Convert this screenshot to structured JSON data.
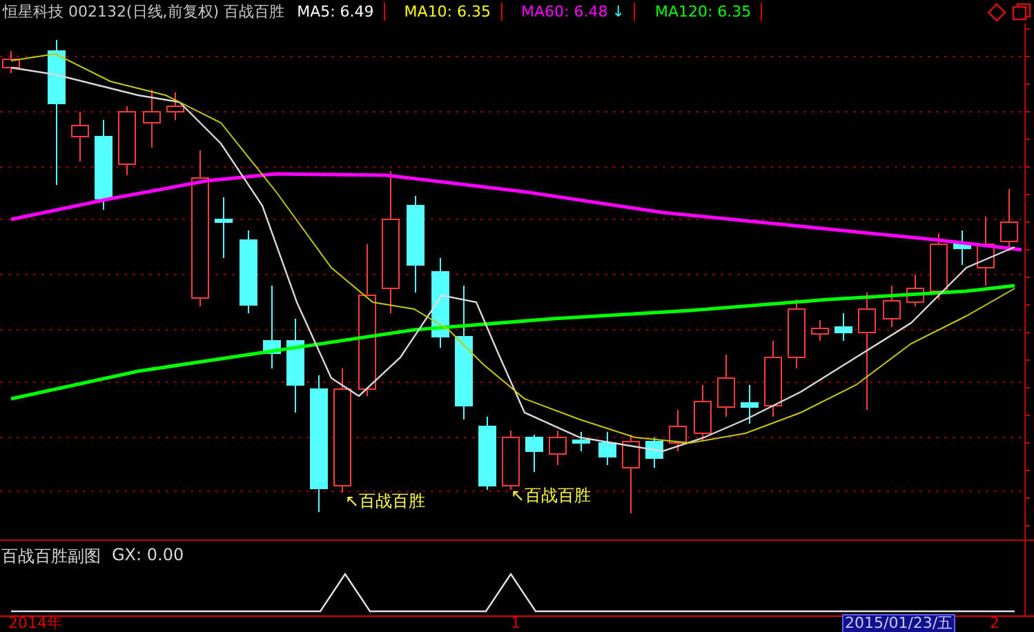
{
  "header": {
    "title": "恒星科技 002132(日线,前复权) 百战百胜",
    "indicators": [
      {
        "label": "MA5: 6.49",
        "color": "#ffffff"
      },
      {
        "label": "MA10: 6.35",
        "color": "#ffff00"
      },
      {
        "label": "MA60: 6.48",
        "color": "#ff00ff",
        "trend": "↓"
      },
      {
        "label": "MA120: 6.35",
        "color": "#00ff00"
      }
    ]
  },
  "main_chart": {
    "annotations": [
      "↖百战百胜",
      "↖百战百胜"
    ]
  },
  "sub_chart": {
    "title": "百战百胜副图",
    "reading": "GX: 0.00"
  },
  "time_axis": [
    {
      "label": "2014年",
      "highlighted": false
    },
    {
      "label": "1",
      "highlighted": false
    },
    {
      "label": "2015/01/23/五",
      "highlighted": true
    },
    {
      "label": "2",
      "highlighted": false
    }
  ]
}
